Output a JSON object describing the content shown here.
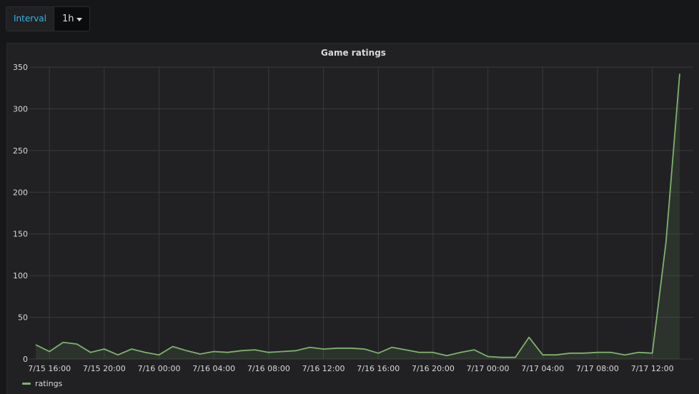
{
  "toolbar": {
    "interval_label": "Interval",
    "interval_value": "1h"
  },
  "panel": {
    "title": "Game ratings"
  },
  "colors": {
    "series": "#7eb26d",
    "grid": "#3a3a3d",
    "axis_text": "#d8d9da",
    "interval_label": "#33b5e5"
  },
  "chart_data": {
    "type": "area",
    "title": "Game ratings",
    "xlabel": "",
    "ylabel": "",
    "ylim": [
      0,
      350
    ],
    "y_ticks": [
      0,
      50,
      100,
      150,
      200,
      250,
      300,
      350
    ],
    "x_ticks": [
      "7/15 16:00",
      "7/15 20:00",
      "7/16 00:00",
      "7/16 04:00",
      "7/16 08:00",
      "7/16 12:00",
      "7/16 16:00",
      "7/16 20:00",
      "7/17 00:00",
      "7/17 04:00",
      "7/17 08:00",
      "7/17 12:00"
    ],
    "grid": true,
    "legend_position": "bottom-left",
    "series": [
      {
        "name": "ratings",
        "color": "#7eb26d",
        "x": [
          "7/15 15:00",
          "7/15 16:00",
          "7/15 17:00",
          "7/15 18:00",
          "7/15 19:00",
          "7/15 20:00",
          "7/15 21:00",
          "7/15 22:00",
          "7/15 23:00",
          "7/16 00:00",
          "7/16 01:00",
          "7/16 02:00",
          "7/16 03:00",
          "7/16 04:00",
          "7/16 05:00",
          "7/16 06:00",
          "7/16 07:00",
          "7/16 08:00",
          "7/16 09:00",
          "7/16 10:00",
          "7/16 11:00",
          "7/16 12:00",
          "7/16 13:00",
          "7/16 14:00",
          "7/16 15:00",
          "7/16 16:00",
          "7/16 17:00",
          "7/16 18:00",
          "7/16 19:00",
          "7/16 20:00",
          "7/16 21:00",
          "7/16 22:00",
          "7/16 23:00",
          "7/17 00:00",
          "7/17 01:00",
          "7/17 02:00",
          "7/17 03:00",
          "7/17 04:00",
          "7/17 05:00",
          "7/17 06:00",
          "7/17 07:00",
          "7/17 08:00",
          "7/17 09:00",
          "7/17 10:00",
          "7/17 11:00",
          "7/17 12:00",
          "7/17 13:00",
          "7/17 14:00"
        ],
        "values": [
          17,
          9,
          20,
          18,
          8,
          12,
          5,
          12,
          8,
          5,
          15,
          10,
          6,
          9,
          8,
          10,
          11,
          8,
          9,
          10,
          14,
          12,
          13,
          13,
          12,
          7,
          14,
          11,
          8,
          8,
          4,
          8,
          11,
          3,
          2,
          2,
          26,
          5,
          5,
          7,
          7,
          8,
          8,
          5,
          8,
          7,
          140,
          342
        ]
      }
    ]
  }
}
